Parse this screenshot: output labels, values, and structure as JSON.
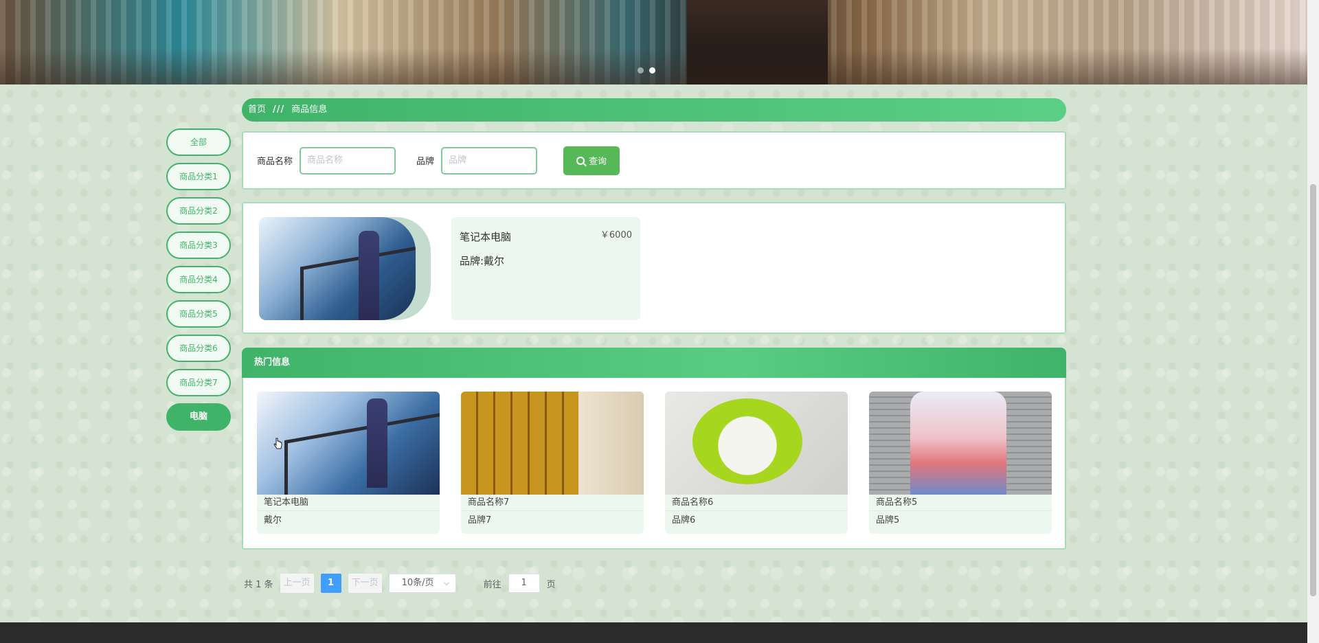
{
  "banner": {
    "slides": 2,
    "active_slide": 2
  },
  "sidebar": {
    "items": [
      {
        "label": "全部",
        "active": false
      },
      {
        "label": "商品分类1",
        "active": false
      },
      {
        "label": "商品分类2",
        "active": false
      },
      {
        "label": "商品分类3",
        "active": false
      },
      {
        "label": "商品分类4",
        "active": false
      },
      {
        "label": "商品分类5",
        "active": false
      },
      {
        "label": "商品分类6",
        "active": false
      },
      {
        "label": "商品分类7",
        "active": false
      },
      {
        "label": "电脑",
        "active": true
      }
    ]
  },
  "breadcrumb": {
    "home": "首页",
    "separator": "///",
    "current": "商品信息"
  },
  "search": {
    "name_label": "商品名称",
    "name_placeholder": "商品名称",
    "name_value": "",
    "brand_label": "品牌",
    "brand_placeholder": "品牌",
    "brand_value": "",
    "button_label": "查询"
  },
  "products": [
    {
      "name": "笔记本电脑",
      "price": "￥6000",
      "brand": "品牌:戴尔"
    }
  ],
  "hot": {
    "title": "热门信息",
    "items": [
      {
        "title": "笔记本电脑",
        "sub": "戴尔"
      },
      {
        "title": "商品名称7",
        "sub": "品牌7"
      },
      {
        "title": "商品名称6",
        "sub": "品牌6"
      },
      {
        "title": "商品名称5",
        "sub": "品牌5"
      }
    ]
  },
  "pagination": {
    "total": "共 1 条",
    "prev": "上一页",
    "current": "1",
    "next": "下一页",
    "page_size": "10条/页",
    "goto_label": "前往",
    "goto_value": "1",
    "page_unit": "页"
  },
  "colors": {
    "accent": "#3fb469",
    "pager_active": "#409eff",
    "footer": "#2b2b2b"
  }
}
